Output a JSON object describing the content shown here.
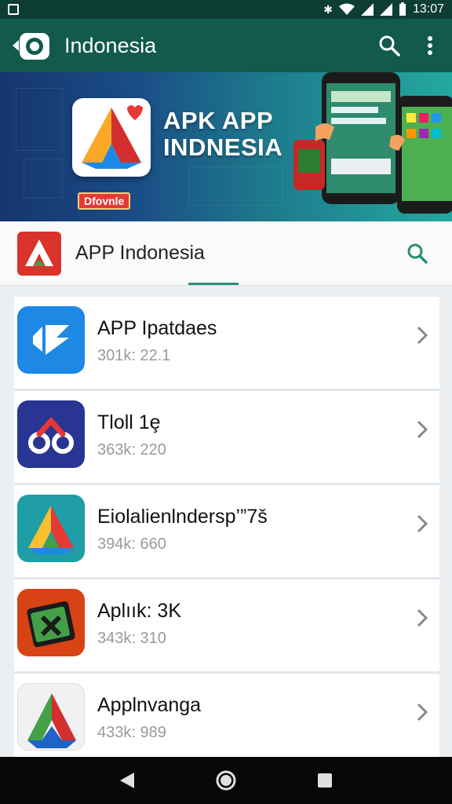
{
  "status_bar": {
    "time": "13:07"
  },
  "app_bar": {
    "title": "Indonesia",
    "icons": [
      "camera-logo-icon",
      "search-icon",
      "overflow-menu-icon"
    ]
  },
  "banner": {
    "line1": "APK APP",
    "line2": "INDNESIA",
    "tag": "Dfovnle"
  },
  "search_row": {
    "title": "APP Indonesia"
  },
  "apps": [
    {
      "name": "APP Ipatdaes",
      "meta": "301k: 22.1",
      "icon": "blue-arrow-icon"
    },
    {
      "name": "Tloll 1ȩ",
      "meta": "363k: 220",
      "icon": "loop-icon"
    },
    {
      "name": "Eiolalienlndersp’”7š",
      "meta": "394k: 660",
      "icon": "triangle-teal-icon"
    },
    {
      "name": "Aplıık: 3K",
      "meta": "343k: 310",
      "icon": "green-x-icon"
    },
    {
      "name": "Applnvanga",
      "meta": "433k: 989",
      "icon": "triangle-white-icon"
    }
  ],
  "nav_bar": {
    "icons": [
      "back-icon",
      "home-icon",
      "recents-icon"
    ]
  },
  "colors": {
    "status_bar": "#0d3d33",
    "app_bar": "#115a4c",
    "accent": "#2a8c7a"
  }
}
